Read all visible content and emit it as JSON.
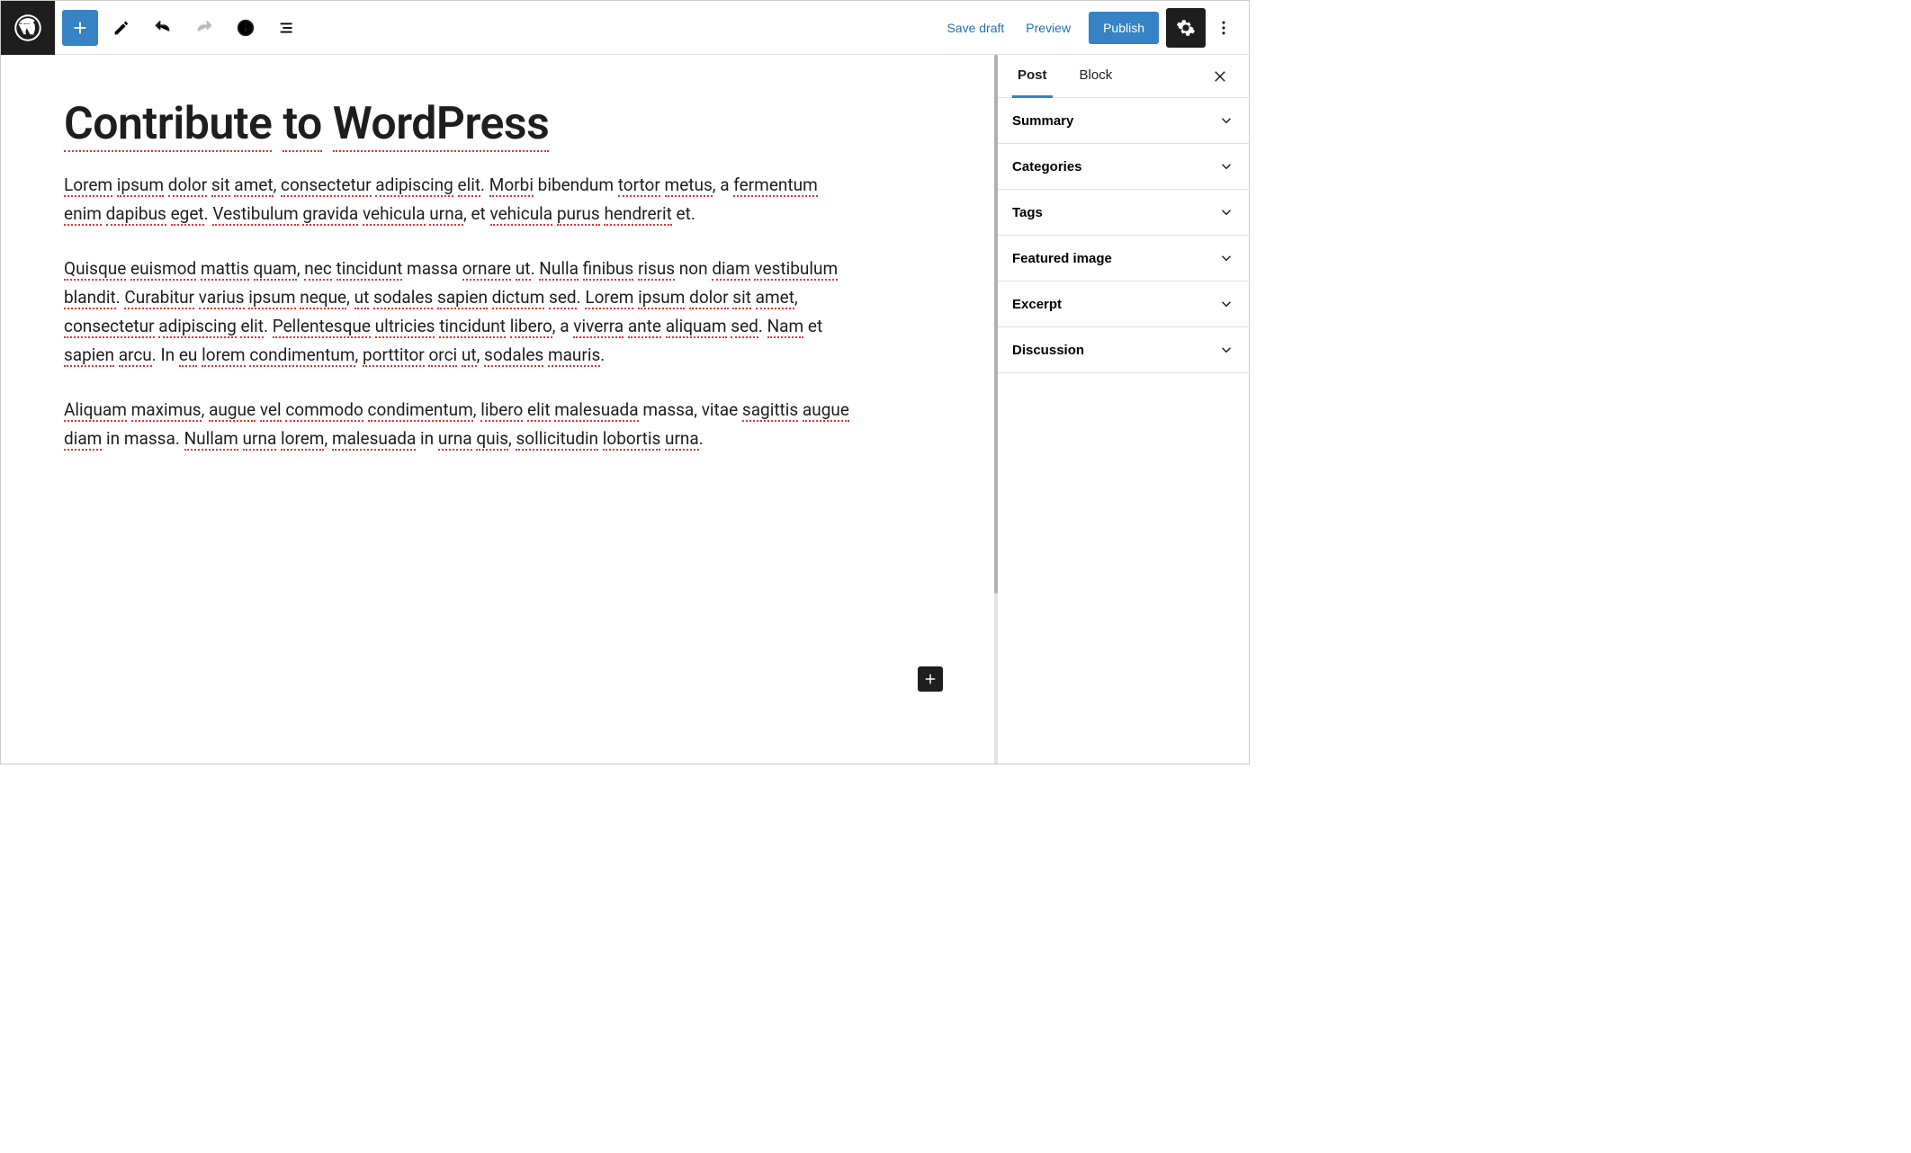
{
  "toolbar": {
    "save_draft": "Save draft",
    "preview": "Preview",
    "publish": "Publish"
  },
  "sidebar": {
    "tabs": {
      "post": "Post",
      "block": "Block"
    },
    "panels": [
      "Summary",
      "Categories",
      "Tags",
      "Featured image",
      "Excerpt",
      "Discussion"
    ]
  },
  "post": {
    "title": "Contribute to WordPress",
    "paragraphs": [
      "Lorem ipsum dolor sit amet, consectetur adipiscing elit. Morbi bibendum tortor metus, a fermentum enim dapibus eget. Vestibulum gravida vehicula urna, et vehicula purus hendrerit et.",
      "Quisque euismod mattis quam, nec tincidunt massa ornare ut. Nulla finibus risus non diam vestibulum blandit. Curabitur varius ipsum neque, ut sodales sapien dictum sed. Lorem ipsum dolor sit amet, consectetur adipiscing elit. Pellentesque ultricies tincidunt libero, a viverra ante aliquam sed. Nam et sapien arcu. In eu lorem condimentum, porttitor orci ut, sodales mauris.",
      "Aliquam maximus, augue vel commodo condimentum, libero elit malesuada massa, vitae sagittis augue diam in massa. Nullam urna lorem, malesuada in urna quis, sollicitudin lobortis urna."
    ]
  },
  "spellcheck_words": [
    "Lorem",
    "ipsum",
    "dolor",
    "sit",
    "amet",
    "consectetur",
    "adipiscing",
    "elit",
    "Morbi",
    "tortor",
    "metus",
    "fermentum",
    "enim",
    "dapibus",
    "eget",
    "Vestibulum",
    "gravida",
    "vehicula",
    "urna",
    "purus",
    "hendrerit",
    "Quisque",
    "euismod",
    "mattis",
    "quam",
    "nec",
    "tincidunt",
    "ornare",
    "ut",
    "Nulla",
    "finibus",
    "risus",
    "diam",
    "vestibulum",
    "blandit",
    "Curabitur",
    "varius",
    "neque",
    "sodales",
    "sapien",
    "Pellentesque",
    "ultricies",
    "libero",
    "viverra",
    "aliquam",
    "sed",
    "Nam",
    "arcu",
    "eu",
    "lorem",
    "condimentum",
    "porttitor",
    "orci",
    "mauris",
    "Aliquam",
    "maximus",
    "augue",
    "vel",
    "commodo",
    "elit",
    "malesuada",
    "sagittis",
    "Nullam",
    "quis",
    "sollicitudin",
    "lobortis",
    "dictum",
    "ante"
  ]
}
